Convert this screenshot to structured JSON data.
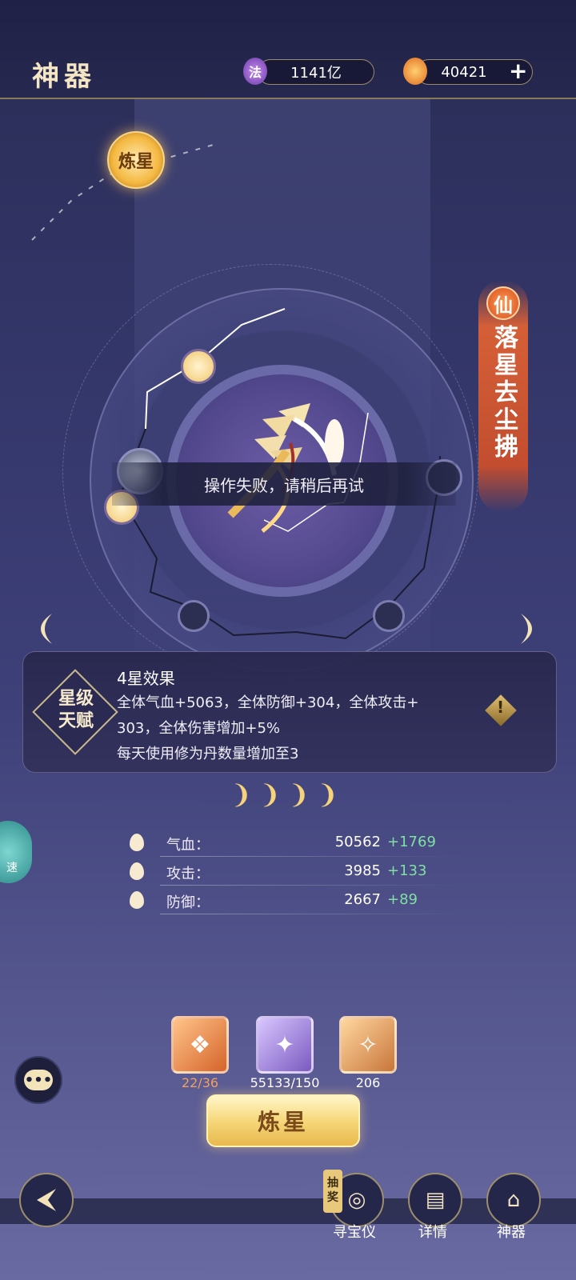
{
  "header": {
    "title": "神器",
    "resource1": {
      "icon": "fa-essence-icon",
      "icon_char": "法",
      "value": "1141亿"
    },
    "resource2": {
      "icon": "flame-gem-icon",
      "value": "40421",
      "add": "+"
    }
  },
  "stage": {
    "refine_badge": "炼星",
    "rarity_badge": "仙",
    "artifact_name": "落星去尘拂",
    "toast": "操作失败，请稍后再试"
  },
  "effect": {
    "badge_line1": "星级",
    "badge_line2": "天赋",
    "title": "4星效果",
    "line1": "全体气血+5063，全体防御+304，全体攻击+",
    "line2": "303，全体伤害增加+5%",
    "line3": "每天使用修为丹数量增加至3"
  },
  "stars": 4,
  "stats": [
    {
      "label": "气血：",
      "value": "50562",
      "plus": "+1769",
      "icon": "blood-drop-icon"
    },
    {
      "label": "攻击：",
      "value": "3985",
      "plus": "+133",
      "icon": "sword-icon"
    },
    {
      "label": "防御：",
      "value": "2667",
      "plus": "+89",
      "icon": "shield-icon"
    }
  ],
  "speed_badge": "速",
  "materials": [
    {
      "count": "22/36",
      "color": "#f0a060"
    },
    {
      "count": "55133/150",
      "color": "#ffffff"
    },
    {
      "count": "206",
      "color": "#ffffff"
    }
  ],
  "main_button": "炼星",
  "bottom_nav": [
    {
      "label": "寻宝仪",
      "tag": "抽奖"
    },
    {
      "label": "详情"
    },
    {
      "label": "神器"
    }
  ]
}
